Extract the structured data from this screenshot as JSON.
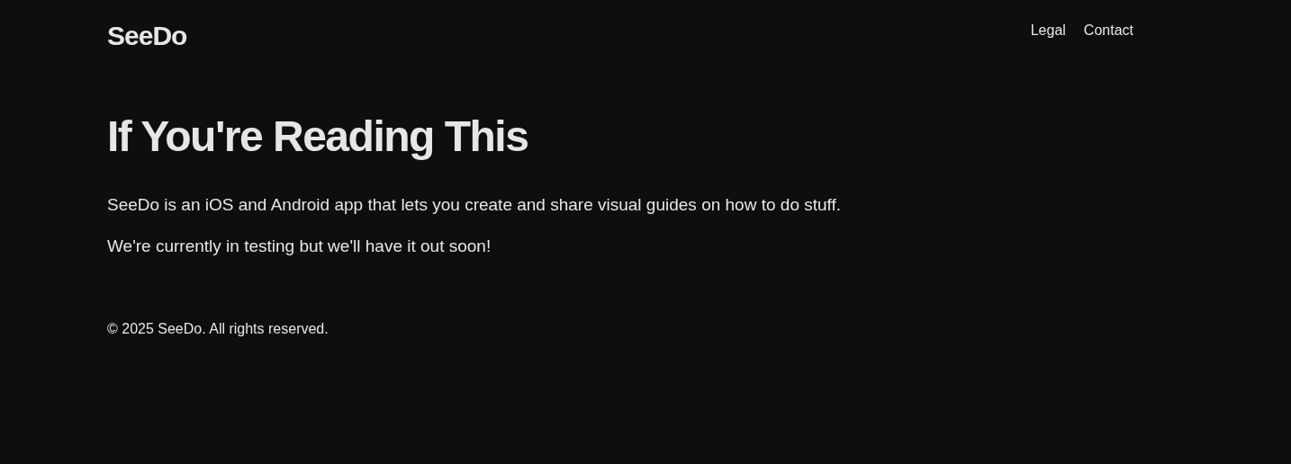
{
  "header": {
    "logo": "SeeDo",
    "nav": [
      {
        "label": "Legal"
      },
      {
        "label": "Contact"
      }
    ]
  },
  "main": {
    "heading": "If You're Reading This",
    "paragraphs": [
      "SeeDo is an iOS and Android app that lets you create and share visual guides on how to do stuff.",
      "We're currently in testing but we'll have it out soon!"
    ]
  },
  "footer": {
    "text": "© 2025 SeeDo. All rights reserved."
  }
}
